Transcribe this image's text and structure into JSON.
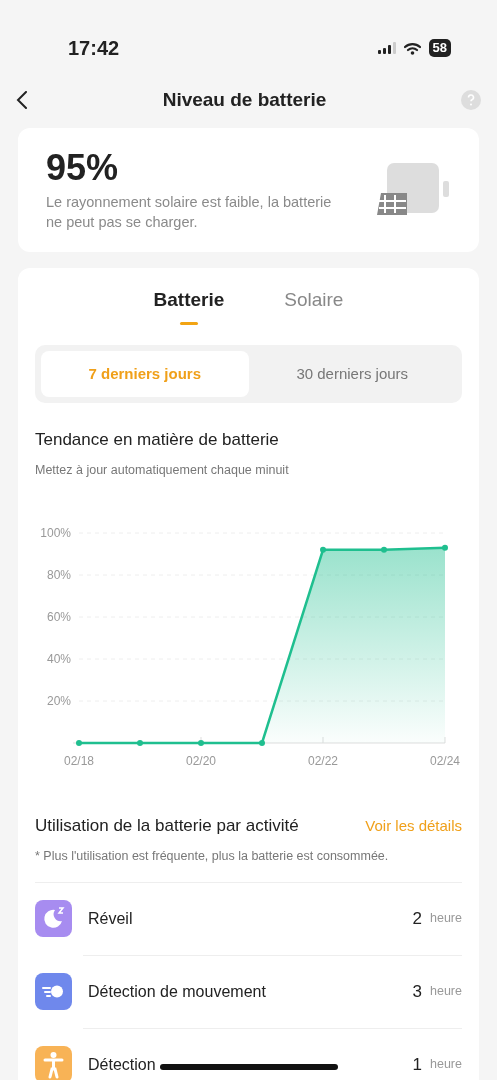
{
  "status_bar": {
    "time": "17:42",
    "battery": "58"
  },
  "header": {
    "title": "Niveau de batterie"
  },
  "summary": {
    "percent": "95%",
    "message": "Le rayonnement solaire est faible, la batterie ne peut pas se charger."
  },
  "tabs": [
    {
      "label": "Batterie",
      "selected": true
    },
    {
      "label": "Solaire",
      "selected": false
    }
  ],
  "periods": [
    {
      "label": "7 derniers jours",
      "selected": true
    },
    {
      "label": "30 derniers jours",
      "selected": false
    }
  ],
  "trend": {
    "title": "Tendance en matière de batterie",
    "subtitle": "Mettez à jour automatiquement chaque minuit",
    "chart_data": {
      "type": "area",
      "categories": [
        "02/18",
        null,
        "02/20",
        null,
        "02/22",
        null,
        "02/24"
      ],
      "series": [
        {
          "color": "#1fbf8f",
          "values": [
            0,
            0,
            0,
            0,
            92,
            92,
            93
          ]
        }
      ],
      "ylim": [
        0,
        100
      ],
      "grid": true,
      "yticks": [
        {
          "value": 20,
          "label": "20%"
        },
        {
          "value": 40,
          "label": "40%"
        },
        {
          "value": 60,
          "label": "60%"
        },
        {
          "value": 80,
          "label": "80%"
        },
        {
          "value": 100,
          "label": "100%"
        }
      ]
    }
  },
  "usage": {
    "title": "Utilisation de la batterie par activité",
    "link": "Voir les détails",
    "note": "* Plus l'utilisation est fréquente, plus la batterie est consommée.",
    "activities": [
      {
        "kind": "wake",
        "color": "#a78cf0",
        "name": "Réveil",
        "value": "2",
        "unit": "heure"
      },
      {
        "kind": "motion",
        "color": "#6f88ec",
        "name": "Détection de mouvement",
        "value": "3",
        "unit": "heure"
      },
      {
        "kind": "human",
        "color": "#f8b356",
        "name": "Détection",
        "value": "1",
        "unit": "heure"
      }
    ]
  }
}
